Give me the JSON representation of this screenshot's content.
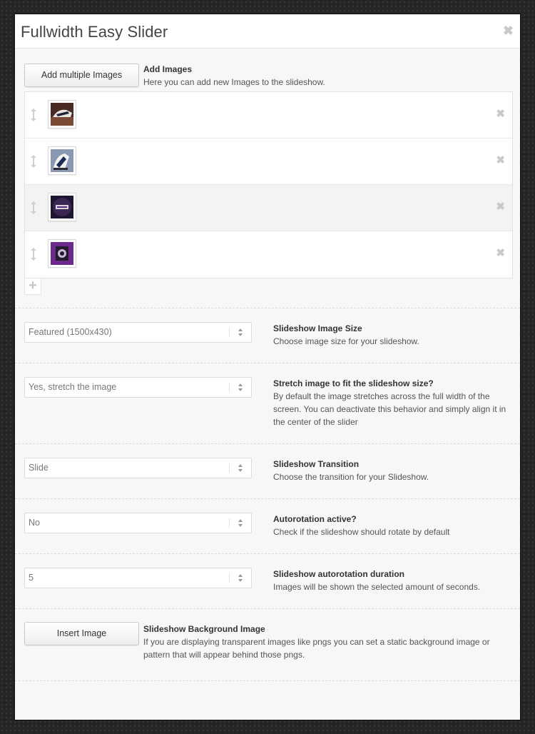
{
  "modal": {
    "title": "Fullwidth Easy Slider",
    "close_icon": "✖"
  },
  "images_section": {
    "button_label": "Add multiple Images",
    "label": "Add Images",
    "description": "Here you can add new Images to the slideshow.",
    "rows": [
      {
        "thumb_icon": "sneaker-photo-thumb",
        "colors": [
          "#6a3b2c",
          "#e8e4e0",
          "#1c2133"
        ]
      },
      {
        "thumb_icon": "sneaker-photo-thumb",
        "colors": [
          "#7a8aa6",
          "#1d2a52",
          "#f1f1f1"
        ]
      },
      {
        "thumb_icon": "dark-purple-photo-thumb",
        "colors": [
          "#221833",
          "#d9d4dc",
          "#5a2c7a"
        ]
      },
      {
        "thumb_icon": "purple-camera-photo-thumb",
        "colors": [
          "#6b2a8c",
          "#231c2e",
          "#c9b7dd"
        ]
      }
    ],
    "remove_icon": "✖",
    "add_icon": "+"
  },
  "image_size": {
    "value": "Featured (1500x430)",
    "label": "Slideshow Image Size",
    "description": "Choose image size for your slideshow."
  },
  "stretch": {
    "value": "Yes, stretch the image",
    "label": "Stretch image to fit the slideshow size?",
    "description": "By default the image stretches across the full width of the screen. You can deactivate this behavior and simply align it in the center of the slider"
  },
  "transition": {
    "value": "Slide",
    "label": "Slideshow Transition",
    "description": "Choose the transition for your Slideshow."
  },
  "autorotation": {
    "value": "No",
    "label": "Autorotation active?",
    "description": "Check if the slideshow should rotate by default"
  },
  "duration": {
    "value": "5",
    "label": "Slideshow autorotation duration",
    "description": "Images will be shown the selected amount of seconds."
  },
  "background": {
    "button_label": "Insert Image",
    "label": "Slideshow Background Image",
    "description": "If you are displaying transparent images like pngs you can set a static background image or pattern that will appear behind those pngs."
  }
}
